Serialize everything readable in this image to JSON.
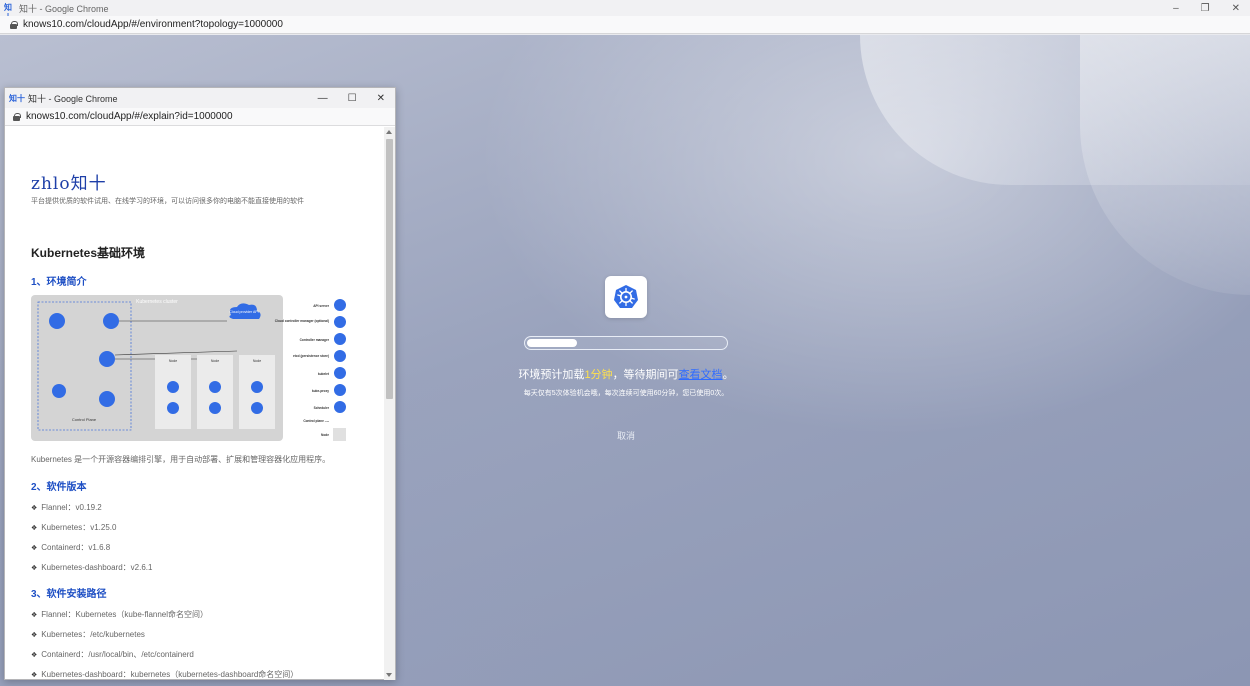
{
  "main_window": {
    "title": "知十 - Google Chrome",
    "app_icon_text": "知十",
    "url": "knows10.com/cloudApp/#/environment?topology=1000000",
    "controls": {
      "minimize": "–",
      "restore": "❐",
      "close": "✕"
    }
  },
  "loader": {
    "logo_icon": "kubernetes-icon",
    "progress": 0.25,
    "message_prefix": "环境预计加载",
    "message_highlight": "1分钟",
    "message_middle": "，等待期间可",
    "message_link": "查看文档",
    "message_suffix": "。",
    "usage_note": "每天仅有5次体验机会哦，每次连续可使用60分钟，您已使用0次。",
    "cancel_label": "取消"
  },
  "popup_window": {
    "title": "知十 - Google Chrome",
    "app_icon_text": "知十",
    "url": "knows10.com/cloudApp/#/explain?id=1000000",
    "controls": {
      "minimize": "—",
      "maximize": "☐",
      "close": "✕"
    }
  },
  "doc": {
    "brand": "zhlo知十",
    "tagline": "平台提供优质的软件试用、在线学习的环境，可以访问很多你的电脑不能直接使用的软件",
    "title": "Kubernetes基础环境",
    "section1": "1、环境简介",
    "diagram": {
      "cluster_label": "Kubernetes cluster",
      "control_plane_label": "Control Plane",
      "cloud_label": "Cloud provider API",
      "node_label": "Node",
      "legend": [
        {
          "label": "API server"
        },
        {
          "label": "Cloud controller manager (optional)"
        },
        {
          "label": "Controller manager"
        },
        {
          "label": "etcd (persistence store)"
        },
        {
          "label": "kubelet"
        },
        {
          "label": "kube-proxy"
        },
        {
          "label": "Scheduler"
        },
        {
          "label": "Control plane ----"
        },
        {
          "label": "Node"
        }
      ]
    },
    "intro": "Kubernetes 是一个开源容器编排引擎，用于自动部署、扩展和管理容器化应用程序。",
    "section2": "2、软件版本",
    "versions": [
      "Flannel：v0.19.2",
      "Kubernetes：v1.25.0",
      "Containerd：v1.6.8",
      "Kubernetes-dashboard：v2.6.1"
    ],
    "section3": "3、软件安装路径",
    "paths": [
      "Flannel：Kubernetes（kube-flannel命名空间）",
      "Kubernetes：/etc/kubernetes",
      "Containerd：/usr/local/bin、/etc/containerd",
      "Kubernetes-dashboard：kubernetes（kubernetes-dashboard命名空间）"
    ]
  },
  "colors": {
    "accent_blue": "#1e4fc4",
    "highlight_yellow": "#ffe14d",
    "k8s_blue": "#326ce5"
  }
}
